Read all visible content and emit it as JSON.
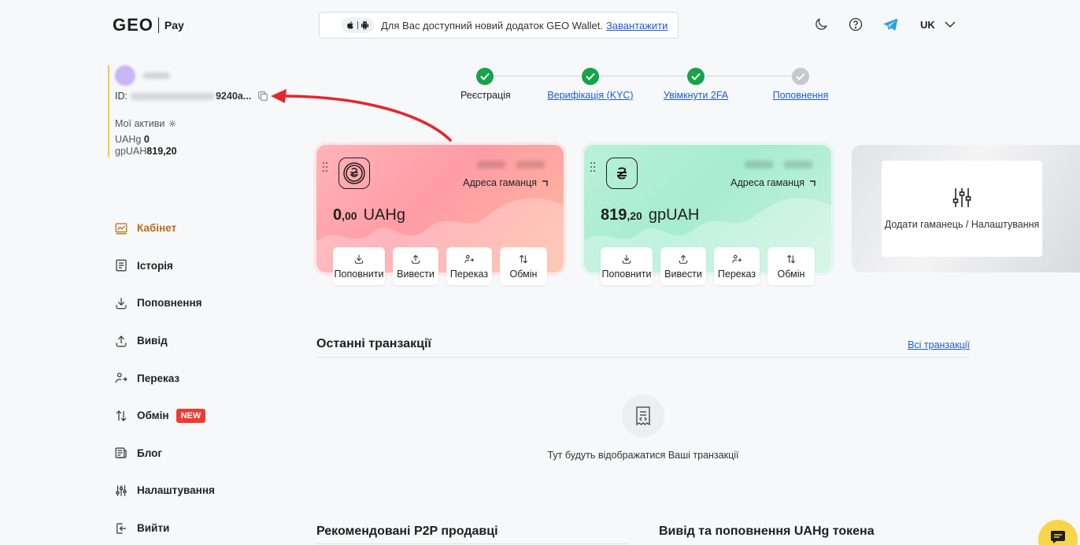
{
  "header": {
    "logo_main": "GEO",
    "logo_sub": "Pay",
    "banner_text": "Для Вас доступний новий додаток GEO Wallet.",
    "banner_link": "Завантажити",
    "language": "UK"
  },
  "profile": {
    "id_label": "ID:",
    "id_tail": "9240a...",
    "assets_title": "Мої активи",
    "assets": [
      {
        "currency": "UAHg",
        "amount": "0"
      },
      {
        "currency": "gpUAH",
        "amount": "819,20"
      }
    ]
  },
  "nav": {
    "items": [
      {
        "label": "Кабінет",
        "icon": "dashboard-icon",
        "active": true
      },
      {
        "label": "Історія",
        "icon": "history-icon"
      },
      {
        "label": "Поповнення",
        "icon": "deposit-icon"
      },
      {
        "label": "Вивід",
        "icon": "withdraw-icon"
      },
      {
        "label": "Переказ",
        "icon": "transfer-icon"
      },
      {
        "label": "Обмін",
        "icon": "exchange-icon",
        "badge": "NEW"
      },
      {
        "label": "Блог",
        "icon": "blog-icon"
      },
      {
        "label": "Налаштування",
        "icon": "settings-icon"
      },
      {
        "label": "Вийти",
        "icon": "logout-icon"
      }
    ]
  },
  "steps": [
    {
      "label": "Реєстрація",
      "done": true
    },
    {
      "label": "Верифікація (KYC)",
      "done": true
    },
    {
      "label": "Увімкнути 2FA",
      "done": true
    },
    {
      "label": "Поповнення",
      "done": false
    }
  ],
  "wallets": [
    {
      "address_label": "Адреса гаманця",
      "balance_int": "0",
      "balance_dec": ",00",
      "currency": "UAHg",
      "color": "#ff9ca5"
    },
    {
      "address_label": "Адреса гаманця",
      "balance_int": "819",
      "balance_dec": ",20",
      "currency": "gpUAH",
      "color": "#a6ecd2"
    }
  ],
  "wallet_actions": {
    "deposit": "Поповнити",
    "withdraw": "Вивести",
    "transfer": "Переказ",
    "exchange": "Обмін"
  },
  "add_wallet": {
    "label": "Додати гаманець / Налаштування"
  },
  "transactions": {
    "title": "Останні транзакції",
    "all_link": "Всі транзакції",
    "empty_text": "Тут будуть відображатися Ваші транзакції"
  },
  "bottom": {
    "p2p_title": "Рекомендовані P2P продавці",
    "token_title": "Вивід та поповнення UAHg токена"
  },
  "colors": {
    "accent": "#b86e13",
    "link": "#1e5bd6",
    "success": "#16a34a",
    "badge": "#ee3a30",
    "chat": "#f7d54a",
    "arrow": "#e5262b"
  }
}
